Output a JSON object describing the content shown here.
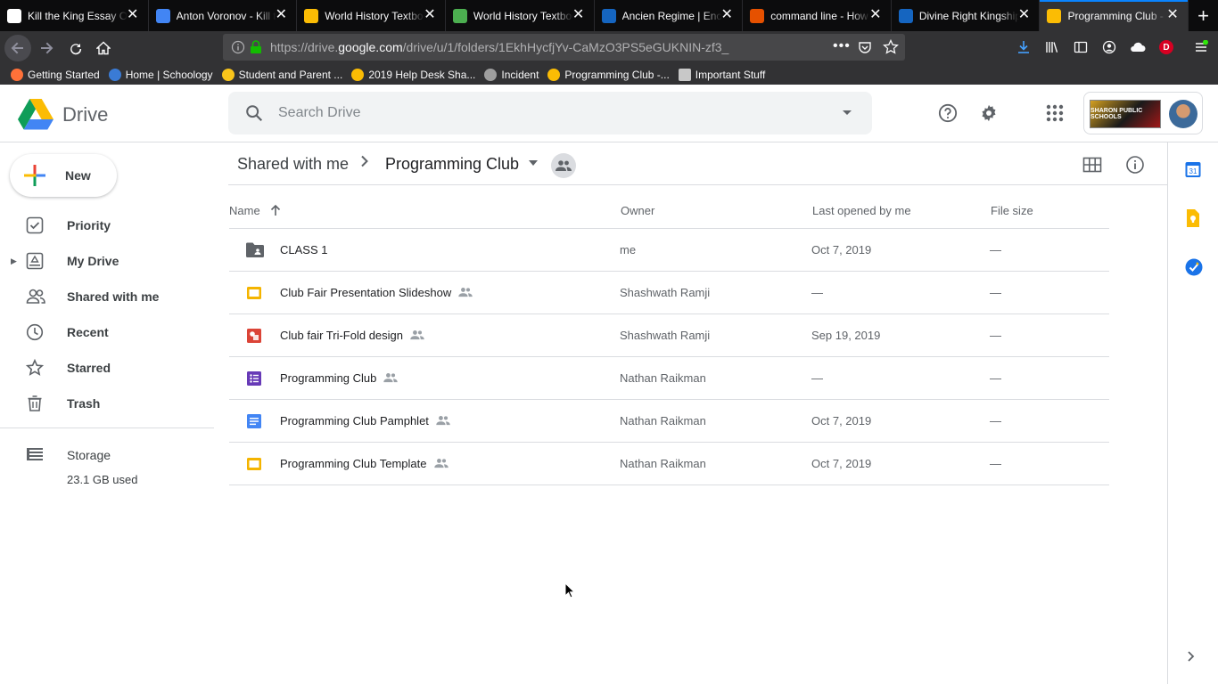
{
  "browser": {
    "tabs": [
      {
        "label": "Kill the King Essay Outline",
        "icon": "schoology-icon",
        "color": "#ffffff"
      },
      {
        "label": "Anton Voronov - Kill the King",
        "icon": "google-docs-icon",
        "color": "#4285f4"
      },
      {
        "label": "World History Textbook",
        "icon": "google-drive-icon",
        "color": "#fbbc04"
      },
      {
        "label": "World History Textbook",
        "icon": "leaf-icon",
        "color": "#4caf50"
      },
      {
        "label": "Ancien Regime | Encyclopedia",
        "icon": "encyclopedia-icon",
        "color": "#1565c0"
      },
      {
        "label": "command line - How",
        "icon": "ask-icon",
        "color": "#e65100"
      },
      {
        "label": "Divine Right Kingship",
        "icon": "encyclopedia-icon",
        "color": "#1565c0"
      },
      {
        "label": "Programming Club - Google Drive",
        "icon": "google-drive-icon",
        "color": "#fbbc04"
      }
    ],
    "url_prefix": "https://drive.",
    "url_domain": "google.com",
    "url_path": "/drive/u/1/folders/1EkhHycfjYv-CaMzO3PS5eGUKNIN-zf3_",
    "bookmarks": [
      {
        "label": "Getting Started",
        "color": "#ff7139"
      },
      {
        "label": "Home | Schoology",
        "color": "#3a7bd5"
      },
      {
        "label": "Student and Parent ...",
        "color": "#f9c51b"
      },
      {
        "label": "2019 Help Desk Sha...",
        "color": "#fbbc04"
      },
      {
        "label": "Incident",
        "color": "#9e9e9e"
      },
      {
        "label": "Programming Club -...",
        "color": "#fbbc04"
      },
      {
        "label": "Important Stuff",
        "color": "#c8c8c8"
      }
    ],
    "profile_letter": "D"
  },
  "header": {
    "app_name": "Drive",
    "search_placeholder": "Search Drive",
    "school_logo_text": "SHARON PUBLIC SCHOOLS"
  },
  "sidebar": {
    "new_label": "New",
    "items": [
      {
        "label": "Priority",
        "icon": "priority-icon"
      },
      {
        "label": "My Drive",
        "icon": "my-drive-icon"
      },
      {
        "label": "Shared with me",
        "icon": "shared-with-me-icon"
      },
      {
        "label": "Recent",
        "icon": "recent-icon"
      },
      {
        "label": "Starred",
        "icon": "starred-icon"
      },
      {
        "label": "Trash",
        "icon": "trash-icon"
      }
    ],
    "storage_label": "Storage",
    "storage_used": "23.1 GB used"
  },
  "breadcrumb": {
    "root": "Shared with me",
    "current": "Programming Club"
  },
  "table": {
    "columns": [
      "Name",
      "Owner",
      "Last opened by me",
      "File size"
    ],
    "rows": [
      {
        "name": "CLASS 1",
        "type": "folder",
        "shared": false,
        "owner": "me",
        "opened": "Oct 7, 2019",
        "size": "—"
      },
      {
        "name": "Club Fair Presentation Slideshow",
        "type": "slides",
        "shared": true,
        "owner": "Shashwath Ramji",
        "opened": "—",
        "size": "—"
      },
      {
        "name": "Club fair Tri-Fold design",
        "type": "drawing",
        "shared": true,
        "owner": "Shashwath Ramji",
        "opened": "Sep 19, 2019",
        "size": "—"
      },
      {
        "name": "Programming Club",
        "type": "form",
        "shared": true,
        "owner": "Nathan Raikman",
        "opened": "—",
        "size": "—"
      },
      {
        "name": "Programming Club Pamphlet",
        "type": "doc",
        "shared": true,
        "owner": "Nathan Raikman",
        "opened": "Oct 7, 2019",
        "size": "—"
      },
      {
        "name": "Programming Club Template",
        "type": "slides",
        "shared": true,
        "owner": "Nathan Raikman",
        "opened": "Oct 7, 2019",
        "size": "—"
      }
    ]
  },
  "right_panel": {
    "calendar_day": "31"
  },
  "colors": {
    "drive_blue": "#4285f4",
    "drive_green": "#0f9d58",
    "drive_yellow": "#fbbc04",
    "drive_red": "#ea4335",
    "slides_yellow": "#f4b400",
    "forms_purple": "#673ab7",
    "docs_blue": "#4285f4",
    "drawing_red": "#db4437",
    "folder_grey": "#5f6368"
  }
}
